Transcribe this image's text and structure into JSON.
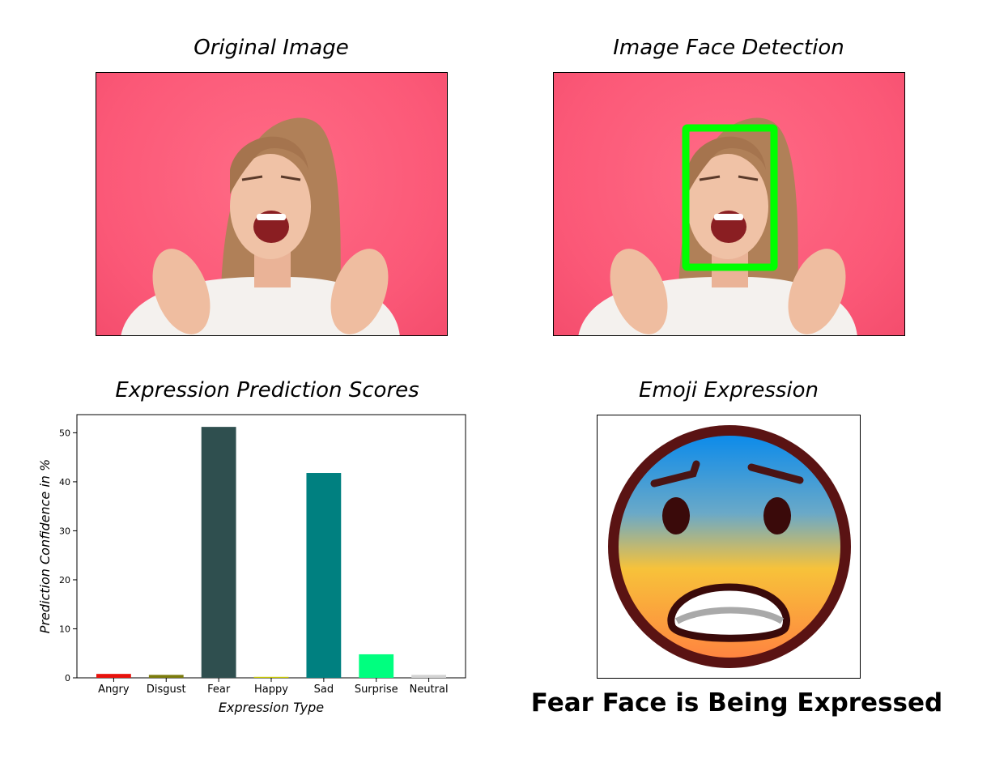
{
  "panels": {
    "original_title": "Original Image",
    "detection_title": "Image Face Detection",
    "chart_title": "Expression Prediction Scores",
    "emoji_title": "Emoji Expression"
  },
  "result_text": "Fear Face is Being Expressed",
  "colors": {
    "photo_background": "#fb5877",
    "detection_box": "#00ff00"
  },
  "emoji": {
    "name": "fearful-face-icon"
  },
  "chart_data": {
    "type": "bar",
    "title": "Expression Prediction Scores",
    "xlabel": "Expression Type",
    "ylabel": "Prediction Confidence in %",
    "categories": [
      "Angry",
      "Disgust",
      "Fear",
      "Happy",
      "Sad",
      "Surprise",
      "Neutral"
    ],
    "values": [
      0.8,
      0.6,
      51.2,
      0.2,
      41.8,
      4.8,
      0.6
    ],
    "colors": [
      "#e8120c",
      "#7b7b0c",
      "#2f4f4f",
      "#c9c900",
      "#008080",
      "#00ff7f",
      "#d3d3d3"
    ],
    "ylim": [
      0,
      53.7
    ],
    "yticks": [
      0,
      10,
      20,
      30,
      40,
      50
    ],
    "grid": false
  }
}
